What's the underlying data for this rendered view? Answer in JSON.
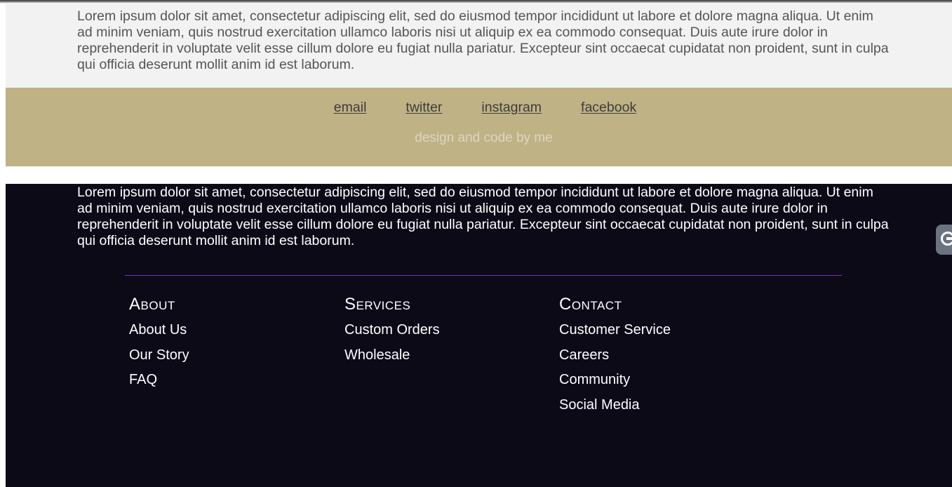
{
  "upper_section": {
    "text": "Lorem ipsum dolor sit amet, consectetur adipiscing elit, sed do eiusmod tempor incididunt ut labore et dolore magna aliqua. Ut enim ad minim veniam, quis nostrud exercitation ullamco laboris nisi ut aliquip ex ea commodo consequat. Duis aute irure dolor in reprehenderit in voluptate velit esse cillum dolore eu fugiat nulla pariatur. Excepteur sint occaecat cupidatat non proident, sunt in culpa qui officia deserunt mollit anim id est laborum."
  },
  "footer_band": {
    "links": [
      "email",
      "twitter",
      "instagram",
      "facebook"
    ],
    "credit": "design and code by me",
    "background": "#bfb285"
  },
  "dark_section": {
    "text": "Lorem ipsum dolor sit amet, consectetur adipiscing elit, sed do eiusmod tempor incididunt ut labore et dolore magna aliqua. Ut enim ad minim veniam, quis nostrud exercitation ullamco laboris nisi ut aliquip ex ea commodo consequat. Duis aute irure dolor in reprehenderit in voluptate velit esse cillum dolore eu fugiat nulla pariatur. Excepteur sint occaecat cupidatat non proident, sunt in culpa qui officia deserunt mollit anim id est laborum.",
    "background": "#0c0a17",
    "divider_color": "#7b2fb8",
    "columns": [
      {
        "heading": "About",
        "items": [
          "About Us",
          "Our Story",
          "FAQ"
        ]
      },
      {
        "heading": "Services",
        "items": [
          "Custom Orders",
          "Wholesale"
        ]
      },
      {
        "heading": "Contact",
        "items": [
          "Customer Service",
          "Careers",
          "Community",
          "Social Media"
        ]
      }
    ]
  },
  "side_tab": {
    "icon": "grammar-assistant-icon"
  }
}
